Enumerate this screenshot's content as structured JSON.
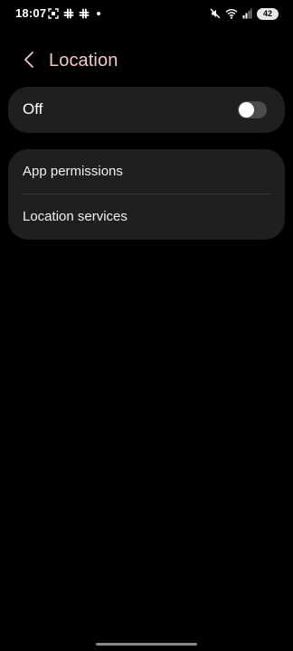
{
  "status_bar": {
    "time": "18:07",
    "left_icons": [
      "screenshot-icon",
      "slack-icon",
      "slack-icon"
    ],
    "right_icons": [
      "mute-icon",
      "wifi-icon",
      "signal-icon"
    ],
    "battery": "42"
  },
  "header": {
    "title": "Location",
    "back_icon": "chevron-left-icon"
  },
  "location_toggle": {
    "label": "Off",
    "state": false
  },
  "settings_list": {
    "items": [
      {
        "label": "App permissions"
      },
      {
        "label": "Location services"
      }
    ]
  },
  "colors": {
    "background": "#000000",
    "card": "#1f1f1f",
    "title_accent": "#f3c8cc",
    "switch_off_track": "#4c4c4c"
  }
}
